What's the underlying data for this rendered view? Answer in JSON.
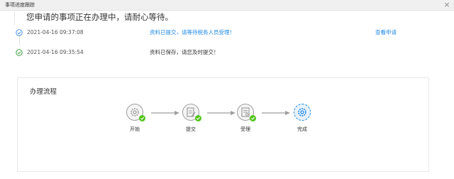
{
  "window": {
    "title": "事项进度跟踪"
  },
  "banner": {
    "text": "您申请的事项正在办理中，请耐心等待。"
  },
  "records": [
    {
      "time": "2021-04-16 09:37:08",
      "message": "资料已提交，请等待税务人员受理！",
      "message_color": "#1e88e5",
      "link": "查看申请",
      "icon": "check-circle-icon",
      "icon_color": "#4a90e2"
    },
    {
      "time": "2021-04-16 09:35:54",
      "message": "资料已保存，请您及时提交！",
      "message_color": "#333333",
      "icon": "check-circle-icon",
      "icon_color": "#43a047"
    }
  ],
  "flow": {
    "title": "办理流程",
    "steps": [
      {
        "label": "开始",
        "icon": "gear-icon",
        "status": "done"
      },
      {
        "label": "提交",
        "icon": "edit-icon",
        "status": "done"
      },
      {
        "label": "受理",
        "icon": "document-icon",
        "status": "done"
      },
      {
        "label": "完成",
        "icon": "gear-icon",
        "status": "current"
      }
    ]
  },
  "colors": {
    "done_check": "#52c41a",
    "current": "#1e88e5",
    "step_gray": "#9e9e9e"
  }
}
